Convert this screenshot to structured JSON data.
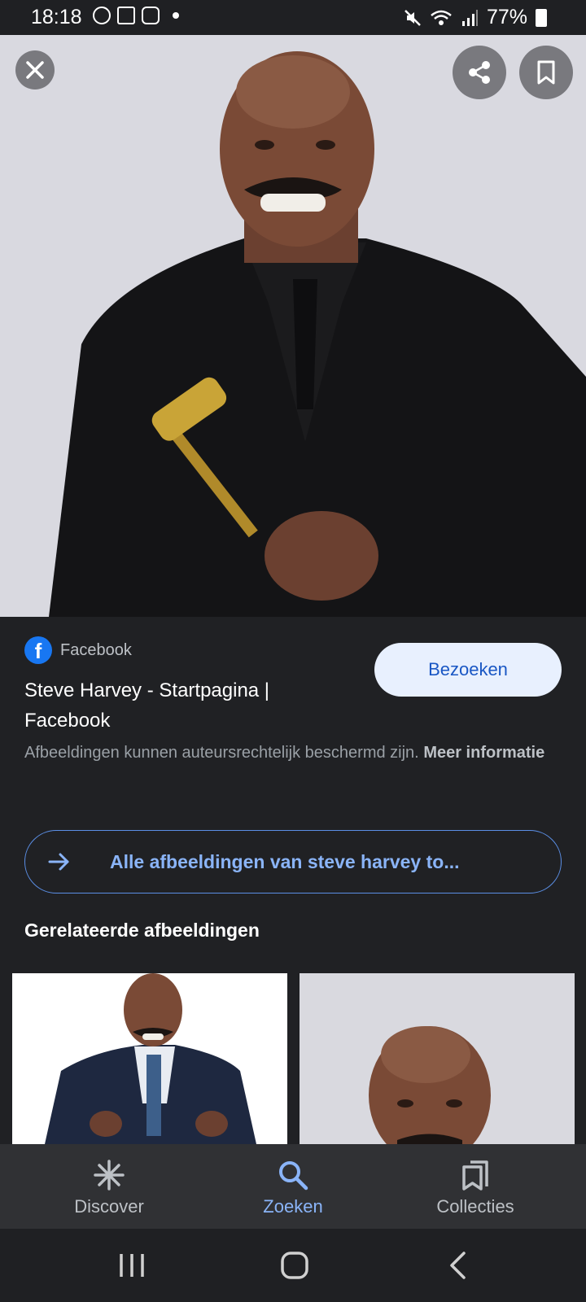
{
  "status_bar": {
    "time": "18:18",
    "battery": "77%",
    "notification_icons": [
      "whatsapp-icon",
      "gallery-icon",
      "instagram-icon"
    ],
    "status_icons": [
      "mute-icon",
      "wifi-icon",
      "signal-icon",
      "battery-icon"
    ]
  },
  "viewer": {
    "close_icon": "close-icon",
    "share_icon": "share-icon",
    "save_icon": "bookmark-icon"
  },
  "result": {
    "source": "Facebook",
    "title": "Steve Harvey - Startpagina | Facebook",
    "visit_label": "Bezoeken",
    "copyright_text": "Afbeeldingen kunnen auteursrechtelijk beschermd zijn.",
    "more_info": "Meer informatie",
    "all_images_label": "Alle afbeeldingen van steve harvey to..."
  },
  "related": {
    "title": "Gerelateerde afbeeldingen"
  },
  "bottom_nav": [
    {
      "label": "Discover",
      "icon": "discover-icon",
      "active": false
    },
    {
      "label": "Zoeken",
      "icon": "search-icon",
      "active": true
    },
    {
      "label": "Collecties",
      "icon": "collections-icon",
      "active": false
    }
  ],
  "colors": {
    "background": "#202124",
    "accent": "#8ab4f8",
    "visit_button_bg": "#e8f0fe",
    "facebook_blue": "#1877f2"
  }
}
